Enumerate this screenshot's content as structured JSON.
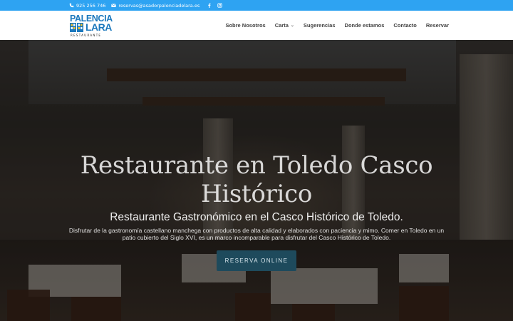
{
  "topbar": {
    "phone": "925 256 746",
    "email": "reservas@asadorpalenciadelara.es",
    "social": [
      {
        "icon": "facebook-icon"
      },
      {
        "icon": "instagram-icon"
      }
    ]
  },
  "logo": {
    "line1": "PALENCIA",
    "line2": "LARA",
    "line3": "RESTAURANTE",
    "color": "#1b78bd"
  },
  "nav": {
    "items": [
      {
        "label": "Sobre Nosotros"
      },
      {
        "label": "Carta",
        "has_dropdown": true
      },
      {
        "label": "Sugerencias"
      },
      {
        "label": "Donde estamos"
      },
      {
        "label": "Contacto"
      },
      {
        "label": "Reservar"
      }
    ]
  },
  "hero": {
    "title": "Restaurante en Toledo Casco Histórico",
    "subtitle": "Restaurante Gastronómico en el Casco Histórico de Toledo.",
    "description": "Disfrutar de la gastronomía castellano manchega con productos de alta calidad y elaborados con paciencia y mimo. Comer en Toledo en un patio cubierto del Siglo XVI, es un marco incomparable para disfrutar del Casco Histórico de Toledo.",
    "cta": "RESERVA ONLINE"
  },
  "colors": {
    "topbar": "#2ea3f2",
    "cta_bg": "#1e4a5c",
    "nav_text": "#444444"
  }
}
